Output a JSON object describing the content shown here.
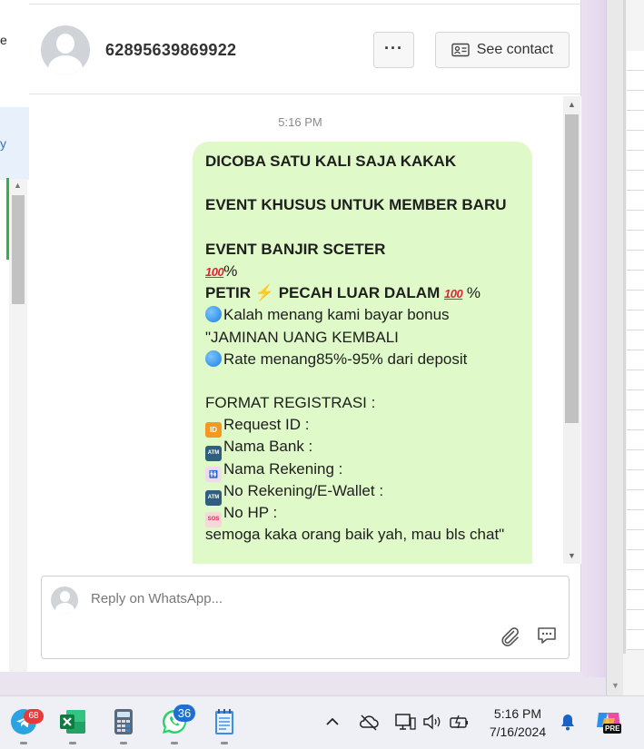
{
  "left_panel": {
    "cut_text_top": "e",
    "cut_text_link": "y"
  },
  "header": {
    "contact_name": "62895639869922",
    "more_label": "···",
    "see_contact_label": "See contact"
  },
  "messages": {
    "timestamp": "5:16 PM",
    "bubble_lines": [
      {
        "text": "DICOBA SATU KALI SAJA KAKAK",
        "bold": true
      },
      {
        "text": "",
        "bold": false
      },
      {
        "text": "EVENT KHUSUS UNTUK MEMBER BARU",
        "bold": true
      },
      {
        "text": "",
        "bold": false
      },
      {
        "text": "EVENT BANJIR SCETER",
        "bold": true
      },
      {
        "pre": "",
        "emoji": "100",
        "text": "%",
        "bold": false
      },
      {
        "text": "PETIR",
        "bold": true
      },
      {
        "text": "Kalah menang kami bayar bonus",
        "bold": false
      },
      {
        "text": "\"JAMINAN UANG KEMBALI",
        "bold": false
      },
      {
        "text": "Rate menang85%-95% dari deposit",
        "bold": false
      },
      {
        "text": "",
        "bold": false
      },
      {
        "text": "FORMAT REGISTRASI :",
        "bold": false
      },
      {
        "text": "Request ID :",
        "bold": false
      },
      {
        "text": "Nama Bank :",
        "bold": false
      },
      {
        "text": "Nama Rekening :",
        "bold": false
      },
      {
        "text": "No Rekening/E-Wallet :",
        "bold": false
      },
      {
        "text": "No HP :",
        "bold": false
      },
      {
        "text": "semoga kaka orang baik yah, mau bls chat\"",
        "bold": false
      }
    ],
    "petir_tail": "PECAH LUAR DALAM",
    "petir_percent": "%",
    "emoji_100": "100",
    "emoji_id": "ID",
    "emoji_atm": "ATM",
    "emoji_sos": "SOS"
  },
  "reply": {
    "placeholder": "Reply on WhatsApp..."
  },
  "taskbar": {
    "telegram_badge": "68",
    "whatsapp_badge": "36",
    "clock_time": "5:16 PM",
    "clock_date": "7/16/2024",
    "copilot_label": "PRE"
  },
  "colors": {
    "bubble": "#dff9c8",
    "accent_blue": "#1f6fd0",
    "whatsapp_green": "#25d366",
    "excel_green": "#1d7044"
  },
  "icons": [
    "more-horizontal-icon",
    "contact-card-icon",
    "paperclip-icon",
    "comment-icon",
    "telegram-icon",
    "excel-icon",
    "calculator-icon",
    "whatsapp-icon",
    "notepad-icon",
    "chevron-up-icon",
    "cloud-offline-icon",
    "network-icon",
    "volume-icon",
    "battery-icon",
    "bell-icon",
    "copilot-icon"
  ]
}
